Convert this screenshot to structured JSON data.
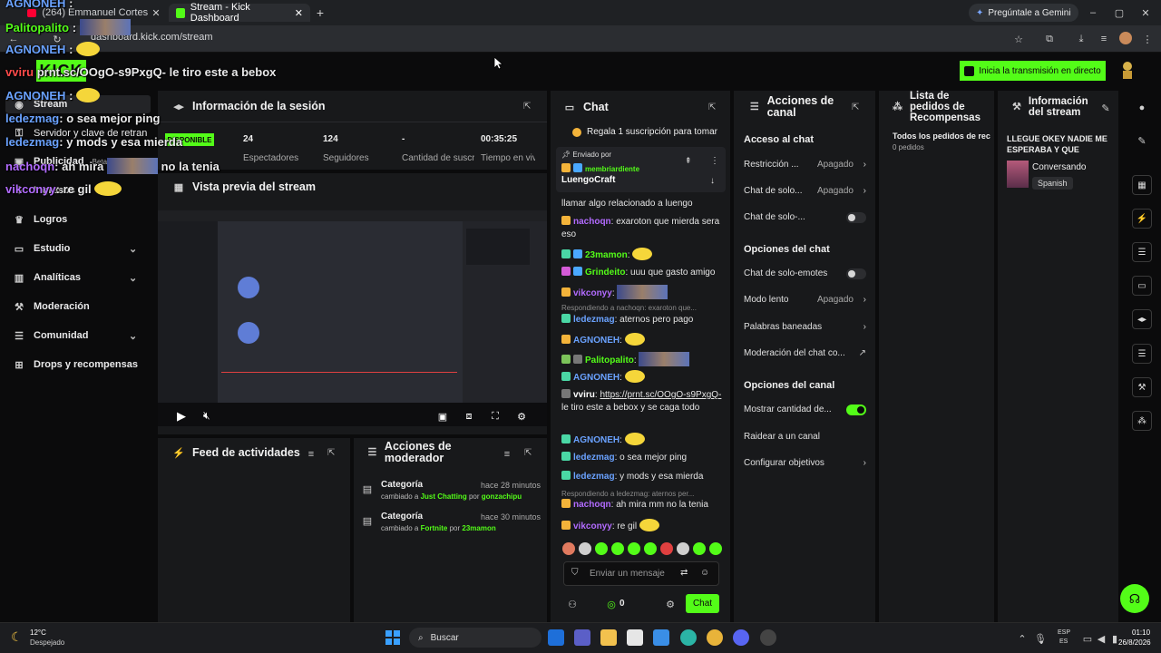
{
  "browser": {
    "tabs": [
      {
        "label": "(264) Emmanuel Cortes - Ar"
      },
      {
        "label": "Stream - Kick Dashboard"
      }
    ],
    "url": "dashboard.kick.com/stream",
    "gemini_label": "Pregúntale a Gemini"
  },
  "header": {
    "go_live_label": "Inicia la transmisión en directo"
  },
  "sidebar": {
    "items": [
      {
        "label": "Stream"
      },
      {
        "label": "Servidor y clave de retran"
      },
      {
        "label": "Publicidad"
      },
      {
        "label": "Ingresos"
      },
      {
        "label": "Logros"
      },
      {
        "label": "Estudio"
      },
      {
        "label": "Analíticas"
      },
      {
        "label": "Moderación"
      },
      {
        "label": "Comunidad"
      },
      {
        "label": "Drops y recompensas"
      }
    ],
    "beta": "Beta"
  },
  "session": {
    "title": "Información de la sesión",
    "badge": "DISPONIBLE",
    "stats": [
      {
        "value": "24",
        "label": "Espectadores"
      },
      {
        "value": "124",
        "label": "Seguidores"
      },
      {
        "value": "-",
        "label": "Cantidad de suscripciones"
      },
      {
        "value": "00:35:25",
        "label": "Tiempo en vivo"
      }
    ]
  },
  "preview": {
    "title": "Vista previa del stream"
  },
  "activity": {
    "title": "Feed de actividades"
  },
  "modactions": {
    "title": "Acciones de moderador",
    "items": [
      {
        "title": "Categoría",
        "prefix": "cambiado a",
        "category": "Just Chatting",
        "by": "por",
        "user": "gonzachipu",
        "time": "hace 28 minutos"
      },
      {
        "title": "Categoría",
        "prefix": "cambiado a",
        "category": "Fortnite",
        "by": "por",
        "user": "23mamon",
        "time": "hace 30 minutos"
      }
    ]
  },
  "chat": {
    "title": "Chat",
    "gift_banner": "Regala 1 suscripción para tomar",
    "pinned_label": "Enviado por",
    "pinned_user": "membriardiente",
    "pinned_text": "LuengoCraft",
    "messages": [
      {
        "user": "",
        "text": "llamar algo relacionado a luengo"
      },
      {
        "user": "nachoqn",
        "text": "exaroton que mierda sera eso",
        "color": "#b26bff"
      },
      {
        "user": "23mamon",
        "text": "",
        "color": "#53fc18"
      },
      {
        "user": "Grindeito",
        "text": "uuu que gasto amigo",
        "color": "#53fc18"
      },
      {
        "user": "vikconyy",
        "text": "",
        "color": "#b26bff"
      },
      {
        "user": "ledezmag",
        "text": "aternos pero pago",
        "color": "#6aa2ff"
      },
      {
        "user": "AGNONEH",
        "text": "",
        "color": "#6aa2ff"
      },
      {
        "user": "Palitopalito",
        "text": "",
        "color": "#53fc18"
      },
      {
        "user": "AGNONEH",
        "text": "",
        "color": "#6aa2ff"
      },
      {
        "user": "vviru",
        "link": "https://prnt.sc/OOgO-s9PxgQ-",
        "text": "le tiro este a bebox y se caga todo",
        "color": "#ffffff"
      },
      {
        "user": "AGNONEH",
        "text": "",
        "color": "#6aa2ff"
      },
      {
        "user": "ledezmag",
        "text": "o sea mejor ping",
        "color": "#6aa2ff"
      },
      {
        "user": "ledezmag",
        "text": "y mods y esa mierda",
        "color": "#6aa2ff"
      },
      {
        "user": "nachoqn",
        "text": "ah mira mm no la tenia",
        "color": "#b26bff"
      },
      {
        "user": "vikconyy",
        "text": "re gil",
        "color": "#b26bff"
      }
    ],
    "replies": [
      "Respondiendo a nachoqn: exaroton que...",
      "Respondiendo a ledezmag: aternos per..."
    ],
    "input_placeholder": "Enviar un mensaje",
    "points": "0",
    "send_label": "Chat"
  },
  "channel_actions": {
    "title": "Acciones de canal",
    "chat_access": "Acceso al chat",
    "rows1": [
      {
        "label": "Restricción ...",
        "value": "Apagado",
        "type": "arrow"
      },
      {
        "label": "Chat de solo...",
        "value": "Apagado",
        "type": "arrow"
      },
      {
        "label": "Chat de solo-...",
        "value": "",
        "type": "toggle-off"
      }
    ],
    "chat_options": "Opciones del chat",
    "rows2": [
      {
        "label": "Chat de solo-emotes",
        "value": "",
        "type": "toggle-off"
      },
      {
        "label": "Modo lento",
        "value": "Apagado",
        "type": "arrow"
      },
      {
        "label": "Palabras baneadas",
        "value": "",
        "type": "arrow"
      },
      {
        "label": "Moderación del chat co...",
        "value": "",
        "type": "external"
      }
    ],
    "channel_options": "Opciones del canal",
    "rows3": [
      {
        "label": "Mostrar cantidad de...",
        "value": "",
        "type": "toggle-on"
      },
      {
        "label": "Raidear a un canal",
        "value": "",
        "type": "none"
      },
      {
        "label": "Configurar objetivos",
        "value": "",
        "type": "arrow"
      }
    ]
  },
  "rewards": {
    "title": "Lista de pedidos de Recompensas",
    "all": "Todos los pedidos de rec",
    "count": "0 pedidos"
  },
  "stream_info": {
    "title": "Información del stream",
    "stream_title": "LLEGUE OKEY NADIE ME ESPERABA Y QUE",
    "category": "Conversando",
    "language": "Spanish"
  },
  "overlay": {
    "lines": [
      {
        "user": "AGNONEH",
        "text": ":",
        "color": "#6aa2ff"
      },
      {
        "user": "Palitopalito",
        "text": ":",
        "color": "#53fc18"
      },
      {
        "user": "AGNONEH",
        "text": ":",
        "color": "#6aa2ff"
      },
      {
        "user": "vviru",
        "text": "prnt.sc/OOgO-s9PxgQ- le tiro este a bebox",
        "color": "#ff4a4a"
      },
      {
        "user": "AGNONEH",
        "text": ":",
        "color": "#6aa2ff"
      },
      {
        "user": "ledezmag",
        "text": ": o sea mejor ping",
        "color": "#6aa2ff"
      },
      {
        "user": "ledezmag",
        "text": ": y mods y esa mierda",
        "color": "#6aa2ff"
      },
      {
        "user": "nachoqn",
        "text": ": ah mira",
        "color": "#b26bff"
      },
      {
        "user": "",
        "text": "no la tenia",
        "color": "#ffffff"
      },
      {
        "user": "vikconyy",
        "text": ": re gil",
        "color": "#b26bff"
      }
    ]
  },
  "taskbar": {
    "weather_temp": "12°C",
    "weather_desc": "Despejado",
    "search_label": "Buscar",
    "lang1": "ESP",
    "lang2": "ES",
    "time": "01:10",
    "date": "26/8/2026"
  },
  "colors": {
    "accent": "#53fc18",
    "panel": "#18191b",
    "background": "#0b0b0c"
  }
}
